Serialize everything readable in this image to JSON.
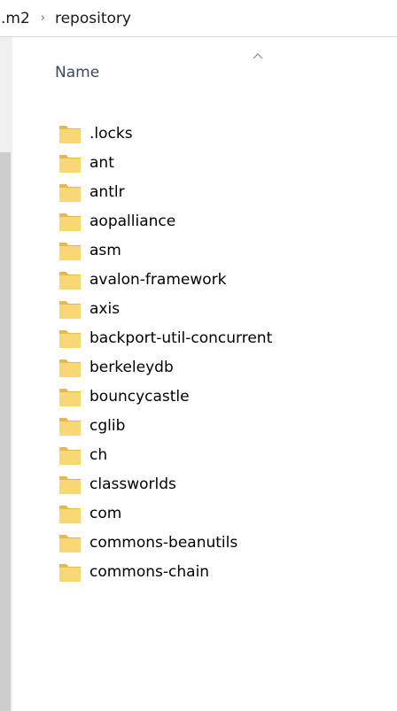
{
  "breadcrumb": {
    "root": ".m2",
    "separator": "›",
    "current": "repository"
  },
  "columns": {
    "name_header": "Name",
    "sort_icon": "chevron-up-icon"
  },
  "colors": {
    "folder_body": "#f8d775",
    "folder_tab": "#e8b84a",
    "scroll_thumb": "#cdcdcd"
  },
  "files": [
    {
      "name": ".locks",
      "icon": "folder-icon"
    },
    {
      "name": "ant",
      "icon": "folder-icon"
    },
    {
      "name": "antlr",
      "icon": "folder-icon"
    },
    {
      "name": "aopalliance",
      "icon": "folder-icon"
    },
    {
      "name": "asm",
      "icon": "folder-icon"
    },
    {
      "name": "avalon-framework",
      "icon": "folder-icon"
    },
    {
      "name": "axis",
      "icon": "folder-icon"
    },
    {
      "name": "backport-util-concurrent",
      "icon": "folder-icon"
    },
    {
      "name": "berkeleydb",
      "icon": "folder-icon"
    },
    {
      "name": "bouncycastle",
      "icon": "folder-icon"
    },
    {
      "name": "cglib",
      "icon": "folder-icon"
    },
    {
      "name": "ch",
      "icon": "folder-icon"
    },
    {
      "name": "classworlds",
      "icon": "folder-icon"
    },
    {
      "name": "com",
      "icon": "folder-icon"
    },
    {
      "name": "commons-beanutils",
      "icon": "folder-icon"
    },
    {
      "name": "commons-chain",
      "icon": "folder-icon"
    }
  ]
}
